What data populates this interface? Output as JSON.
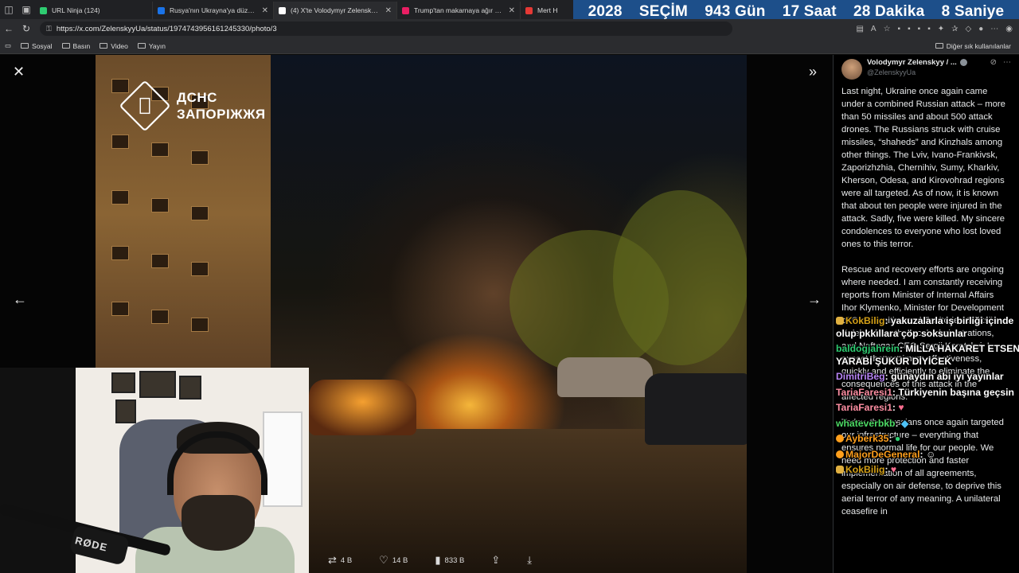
{
  "browser": {
    "tabs": [
      {
        "label": "URL Ninja (124)",
        "favicon_color": "#2ecc71"
      },
      {
        "label": "Rusya'nın Ukrayna'ya düzenledi",
        "favicon_color": "#1a73e8"
      },
      {
        "label": "(4) X'te Volodymyr Zelenskyy / Ε",
        "favicon_color": "#ffffff"
      },
      {
        "label": "Trump'tan makarnaya ağır darb",
        "favicon_color": "#e91e63"
      },
      {
        "label": "Mert H",
        "favicon_color": "#e53935"
      }
    ],
    "url": "https://x.com/ZelenskyyUa/status/1974743956161245330/photo/3",
    "bookmarks": [
      "Sosyal",
      "Basın",
      "Video",
      "Yayın"
    ],
    "other_bookmarks": "Diğer sık kullanılanlar"
  },
  "countdown": {
    "year": "2028",
    "label": "SEÇİM",
    "days": "943 Gün",
    "hours": "17 Saat",
    "minutes": "28 Dakika",
    "seconds": "8 Saniye"
  },
  "photo": {
    "watermark_line1": "ДСНС",
    "watermark_line2": "ЗАПОРІЖЖЯ"
  },
  "actions": {
    "reposts": "4 B",
    "likes": "14 B",
    "views": "833 B"
  },
  "webcam": {
    "mic_brand": "RØDE"
  },
  "author": {
    "name": "Volodymyr Zelenskyy / ...",
    "handle": "@ZelenskyyUa"
  },
  "post": {
    "paragraph1": "Last night, Ukraine once again came under a combined Russian attack – more than 50 missiles and about 500 attack drones. The Russians struck with cruise missiles, “shaheds” and Kinzhals among other things. The Lviv, Ivano-Frankivsk, Zaporizhzhia, Chernihiv, Sumy, Kharkiv, Kherson, Odesa, and Kirovohrad regions were all targeted. As of now, it is known that about ten people were injured in the attack. Sadly, five were killed. My sincere condolences to everyone who lost loved ones to this terror.",
    "paragraph2": "Rescue and recovery efforts are ongoing where needed. I am constantly receiving reports from Minister of Internal Affairs Ihor Klymenko, Minister for Development of Communities and Territories Oleksii Kuleba, from the local administrations, and Naftogaz CEO Sergii Koretskyi. I expect the maximum effectiveness, quickly and efficiently to eliminate the consequences of this attack in the affected regions.",
    "paragraph3": "Today, the Russians once again targeted our infrastructure – everything that ensures normal life for our people. We need more protection and faster implementation of all agreements, especially on air defense, to deprive this aerial terror of any meaning. A unilateral ceasefire in"
  },
  "chat": [
    {
      "user": "KokBilig",
      "color": "#d4a017",
      "text": "yakuzalarla iş birliği içinde olup pkkıllara çöp soksunlar"
    },
    {
      "user": "baldogjahrein",
      "color": "#2ecc71",
      "text": "MİLLA HAKARET ETSEN YARABİ ŞÜKÜR DİYİCEK"
    },
    {
      "user": "DimitriBeg",
      "color": "#b784f5",
      "text": "günaydın abi iyi yayınlar"
    },
    {
      "user": "TariaFaresi1",
      "color": "#ff8fa3",
      "text": "Türkiyenin başına geçsin"
    },
    {
      "user": "TariaFaresi1",
      "color": "#ff8fa3",
      "text": ""
    },
    {
      "user": "whateverbkb",
      "color": "#4cd964",
      "text": ""
    },
    {
      "user": "Ayberk35",
      "color": "#ff9f1c",
      "text": ""
    },
    {
      "user": "MajorDeGeneral",
      "color": "#ff9f1c",
      "text": ""
    },
    {
      "user": "KokBilig",
      "color": "#d4a017",
      "text": ""
    }
  ]
}
